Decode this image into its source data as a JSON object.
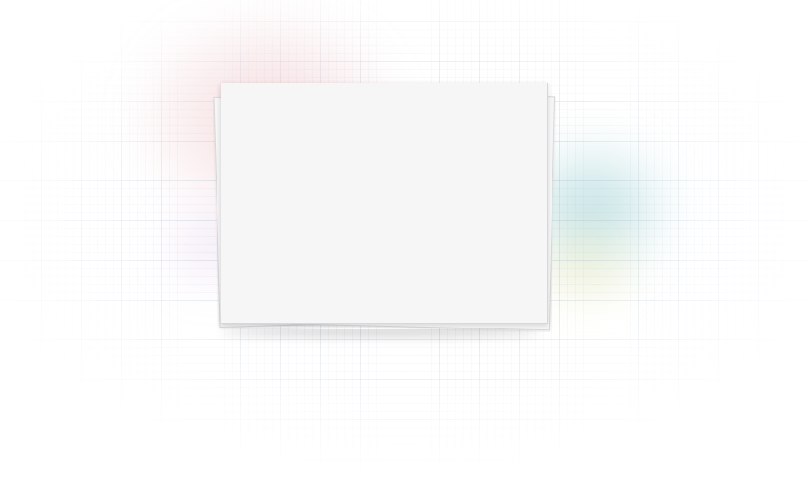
{
  "scene": {
    "background_color": "#ffffff",
    "card_color": "#f6f6f7",
    "glow_colors": {
      "red": "#e6aaaf",
      "violet": "#d2aadc",
      "teal": "#78bec3",
      "yellow": "#e1dc8c"
    },
    "card_stack": {
      "content": ""
    }
  }
}
